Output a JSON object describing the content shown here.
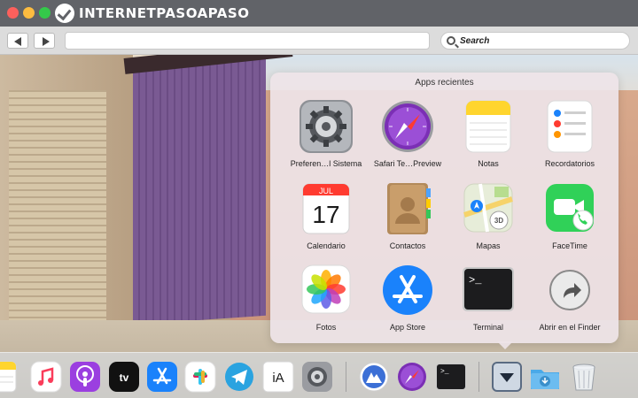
{
  "brand": {
    "logo_text": "INTERNETPASOAPASO"
  },
  "toolbar": {
    "search_placeholder": "Search"
  },
  "stack": {
    "title": "Apps recientes",
    "apps": [
      {
        "label": "Preferen…l Sistema",
        "icon": "system-preferences-icon"
      },
      {
        "label": "Safari Te…Preview",
        "icon": "safari-preview-icon"
      },
      {
        "label": "Notas",
        "icon": "notes-icon"
      },
      {
        "label": "Recordatorios",
        "icon": "reminders-icon"
      },
      {
        "label": "Calendario",
        "icon": "calendar-icon",
        "month": "JUL",
        "day": "17"
      },
      {
        "label": "Contactos",
        "icon": "contacts-icon"
      },
      {
        "label": "Mapas",
        "icon": "maps-icon",
        "badge": "3D"
      },
      {
        "label": "FaceTime",
        "icon": "facetime-icon"
      },
      {
        "label": "Fotos",
        "icon": "photos-icon"
      },
      {
        "label": "App Store",
        "icon": "app-store-icon"
      },
      {
        "label": "Terminal",
        "icon": "terminal-icon",
        "prompt": ">_"
      },
      {
        "label": "Abrir en el Finder",
        "icon": "open-in-finder-icon"
      }
    ]
  },
  "dock": {
    "items": [
      {
        "name": "notes",
        "icon": "notes-icon"
      },
      {
        "name": "music",
        "icon": "music-icon"
      },
      {
        "name": "podcasts",
        "icon": "podcasts-icon"
      },
      {
        "name": "apple-tv",
        "icon": "apple-tv-icon",
        "label": "tv"
      },
      {
        "name": "app-store",
        "icon": "app-store-icon"
      },
      {
        "name": "slack",
        "icon": "slack-icon"
      },
      {
        "name": "telegram",
        "icon": "telegram-icon"
      },
      {
        "name": "ia-writer",
        "icon": "ia-writer-icon",
        "label": "iA"
      },
      {
        "name": "system-preferences",
        "icon": "gear-icon"
      },
      {
        "name": "nordvpn",
        "icon": "nordvpn-icon"
      },
      {
        "name": "safari-preview",
        "icon": "safari-preview-icon"
      },
      {
        "name": "terminal",
        "icon": "terminal-icon",
        "prompt": ">_"
      },
      {
        "name": "apps-stack",
        "icon": "stack-down-arrow-icon"
      },
      {
        "name": "downloads",
        "icon": "downloads-folder-icon"
      },
      {
        "name": "trash",
        "icon": "trash-icon"
      }
    ]
  },
  "colors": {
    "titlebar": "#616368",
    "accent_blue": "#1a82fb",
    "safari_purple": "#7b2fb5"
  }
}
